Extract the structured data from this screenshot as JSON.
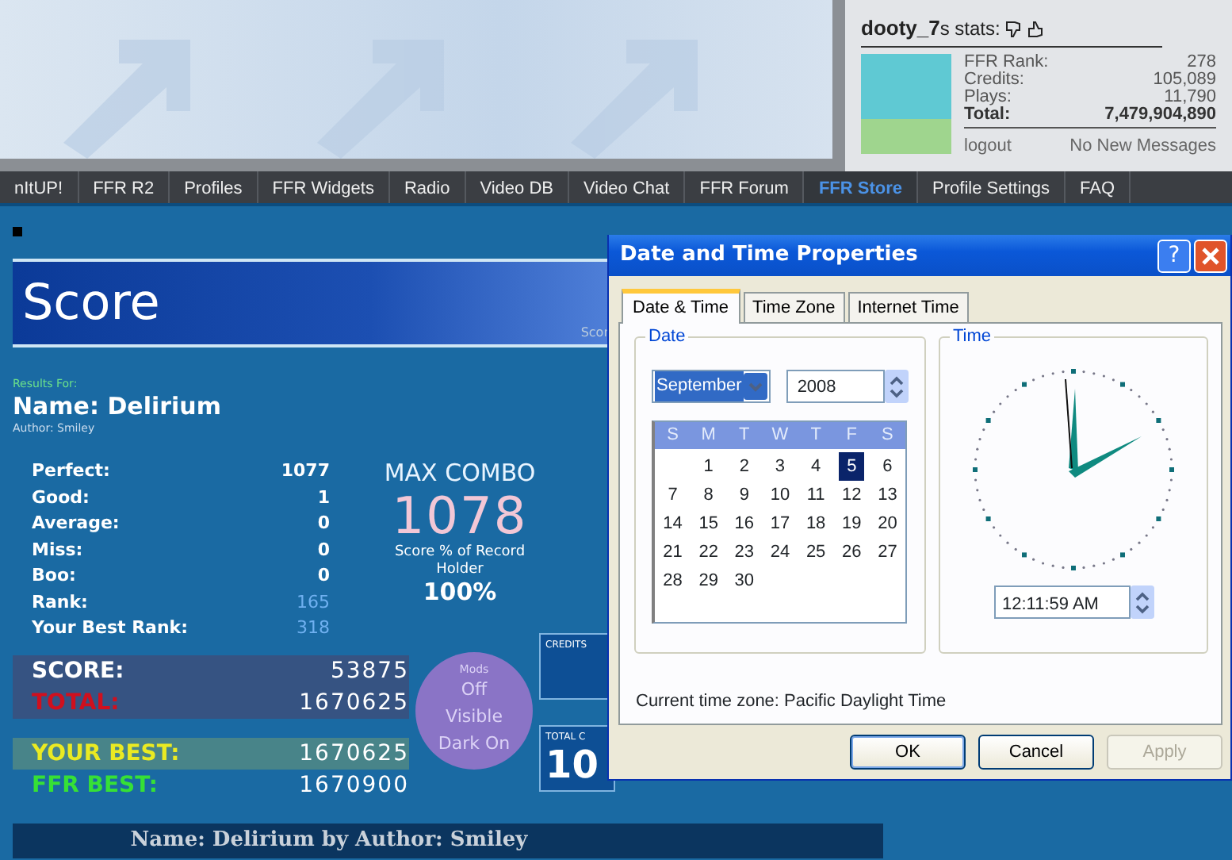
{
  "header": {
    "user_stats": {
      "heading": "**dooty_7**s stats:",
      "rows": [
        {
          "label": "FFR Rank:",
          "value": "278",
          "emphasis": false
        },
        {
          "label": "Credits:",
          "value": "105,089",
          "emphasis": false
        },
        {
          "label": "Plays:",
          "value": "11,790",
          "emphasis": false
        },
        {
          "label": "Total:",
          "value": "7,479,904,890",
          "emphasis": true
        }
      ],
      "logout": "logout",
      "messages": "No New Messages"
    }
  },
  "nav": {
    "items": [
      {
        "label": "nItUP!",
        "selected": false
      },
      {
        "label": "FFR R2",
        "selected": false
      },
      {
        "label": "Profiles",
        "selected": false
      },
      {
        "label": "FFR Widgets",
        "selected": false
      },
      {
        "label": "Radio",
        "selected": false
      },
      {
        "label": "Video DB",
        "selected": false
      },
      {
        "label": "Video Chat",
        "selected": false
      },
      {
        "label": "FFR Forum",
        "selected": false
      },
      {
        "label": "FFR Store",
        "selected": true
      },
      {
        "label": "Profile Settings",
        "selected": false
      },
      {
        "label": "FAQ",
        "selected": false
      }
    ]
  },
  "score_screen": {
    "title": "Score",
    "side_label": "Scor",
    "results_for": "Results For:",
    "song_name": "Name: Delirium",
    "author": "Author: Smiley",
    "judgements": [
      {
        "label": "Perfect:",
        "value": "1077",
        "kind": "count"
      },
      {
        "label": "Good:",
        "value": "1",
        "kind": "count"
      },
      {
        "label": "Average:",
        "value": "0",
        "kind": "count"
      },
      {
        "label": "Miss:",
        "value": "0",
        "kind": "count"
      },
      {
        "label": "Boo:",
        "value": "0",
        "kind": "count"
      },
      {
        "label": "Rank:",
        "value": "165",
        "kind": "rank"
      },
      {
        "label": "Your Best Rank:",
        "value": "318",
        "kind": "rank"
      }
    ],
    "max_combo_label": "MAX COMBO",
    "max_combo": "1078",
    "record_label": "Score % of Record Holder",
    "record_percent": "100%",
    "totals": [
      {
        "label": "SCORE:",
        "value": "53875",
        "kind": "score"
      },
      {
        "label": "TOTAL:",
        "value": "1670625",
        "kind": "total"
      },
      {
        "label": "YOUR BEST:",
        "value": "1670625",
        "kind": "your_best"
      },
      {
        "label": "FFR BEST:",
        "value": "1670900",
        "kind": "ffr_best"
      }
    ],
    "mods": {
      "label": "Mods",
      "values": [
        "Off",
        "Visible",
        "Dark On"
      ]
    },
    "credits_label": "CREDITS",
    "total_credits_label": "TOTAL C",
    "total_credits_value": "10",
    "footer": "Name: Delirium by Author: Smiley"
  },
  "dialog": {
    "title": "Date and Time Properties",
    "help_glyph": "?",
    "tabs": [
      {
        "label": "Date & Time",
        "selected": true
      },
      {
        "label": "Time Zone",
        "selected": false
      },
      {
        "label": "Internet Time",
        "selected": false
      }
    ],
    "date_group": "Date",
    "month": "September",
    "year": "2008",
    "weekdays": [
      "S",
      "M",
      "T",
      "W",
      "T",
      "F",
      "S"
    ],
    "weeks": [
      {
        "kind": "first",
        "days": [
          {
            "day": "1",
            "selected": false
          },
          {
            "day": "2",
            "selected": false
          },
          {
            "day": "3",
            "selected": false
          },
          {
            "day": "4",
            "selected": false
          },
          {
            "day": "5",
            "selected": true
          },
          {
            "day": "6",
            "selected": false
          }
        ]
      },
      {
        "kind": "full",
        "days": [
          {
            "day": "7",
            "selected": false
          },
          {
            "day": "8",
            "selected": false
          },
          {
            "day": "9",
            "selected": false
          },
          {
            "day": "10",
            "selected": false
          },
          {
            "day": "11",
            "selected": false
          },
          {
            "day": "12",
            "selected": false
          },
          {
            "day": "13",
            "selected": false
          }
        ]
      },
      {
        "kind": "full",
        "days": [
          {
            "day": "14",
            "selected": false
          },
          {
            "day": "15",
            "selected": false
          },
          {
            "day": "16",
            "selected": false
          },
          {
            "day": "17",
            "selected": false
          },
          {
            "day": "18",
            "selected": false
          },
          {
            "day": "19",
            "selected": false
          },
          {
            "day": "20",
            "selected": false
          }
        ]
      },
      {
        "kind": "full",
        "days": [
          {
            "day": "21",
            "selected": false
          },
          {
            "day": "22",
            "selected": false
          },
          {
            "day": "23",
            "selected": false
          },
          {
            "day": "24",
            "selected": false
          },
          {
            "day": "25",
            "selected": false
          },
          {
            "day": "26",
            "selected": false
          },
          {
            "day": "27",
            "selected": false
          }
        ]
      },
      {
        "kind": "last",
        "days": [
          {
            "day": "28",
            "selected": false
          },
          {
            "day": "29",
            "selected": false
          },
          {
            "day": "30",
            "selected": false
          }
        ]
      }
    ],
    "time_group": "Time",
    "time": "12:11:59 AM",
    "timezone": "Current time zone:  Pacific Daylight Time",
    "buttons": [
      {
        "label": "OK",
        "kind": "default",
        "disabled": false
      },
      {
        "label": "Cancel",
        "kind": "normal",
        "disabled": false
      },
      {
        "label": "Apply",
        "kind": "normal",
        "disabled": true
      }
    ]
  }
}
